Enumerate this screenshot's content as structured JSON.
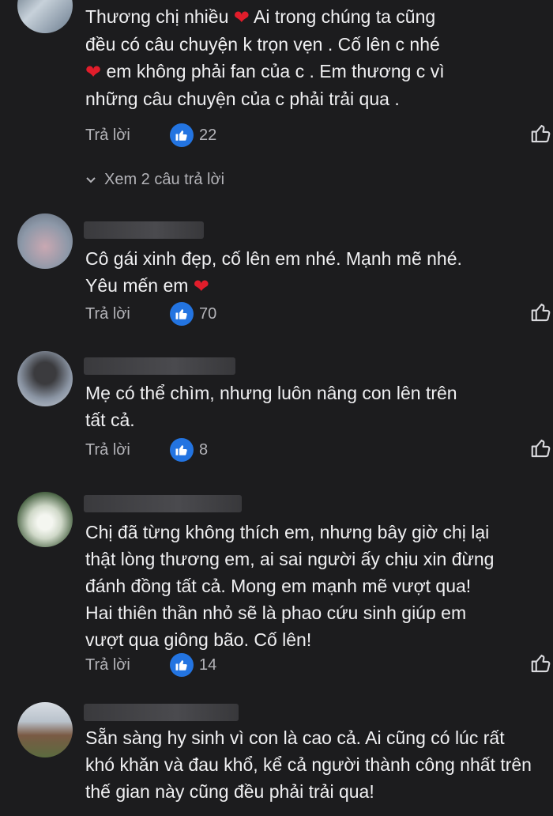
{
  "comments": [
    {
      "text_parts": [
        "Thương chị nhiều ",
        " Ai trong chúng ta cũng\nđều có câu chuyện k trọn vẹn . Cố lên c nhé\n",
        " em không phải fan của c . Em thương c vì\nnhững câu chuyện của c phải trải qua ."
      ],
      "reply": "Trả lời",
      "likes": "22",
      "replies_link": "Xem 2 câu trả lời"
    },
    {
      "text_parts": [
        "Cô gái xinh đẹp, cố lên em nhé. Mạnh mẽ nhé.\nYêu mến em "
      ],
      "reply": "Trả lời",
      "likes": "70"
    },
    {
      "text": "Mẹ có thể chìm, nhưng luôn nâng con lên trên\ntất cả.",
      "reply": "Trả lời",
      "likes": "8"
    },
    {
      "text": "Chị đã từng không thích em, nhưng bây giờ chị lại\nthật lòng thương em, ai sai người ấy chịu xin đừng\nđánh đồng tất cả. Mong em mạnh mẽ vượt qua!\nHai thiên thần nhỏ sẽ là phao cứu sinh giúp em\nvượt qua giông bão. Cố lên!",
      "reply": "Trả lời",
      "likes": "14"
    },
    {
      "text": "Sẵn sàng hy sinh vì con là cao cả. Ai cũng có lúc rất\nkhó khăn và đau khổ, kể cả người thành công nhất trên\nthế gian này cũng đều phải trải qua!"
    }
  ],
  "icons": {
    "heart": "heart-emoji",
    "like_badge": "thumbs-up-badge-icon",
    "like_button": "thumbs-up-outline-icon",
    "chevron": "chevron-down-icon"
  },
  "colors": {
    "background": "#1c1c1e",
    "text": "#f0f0f2",
    "muted": "#b3b3b8",
    "like_blue": "#2374e1",
    "heart_red": "#e11d2b"
  }
}
